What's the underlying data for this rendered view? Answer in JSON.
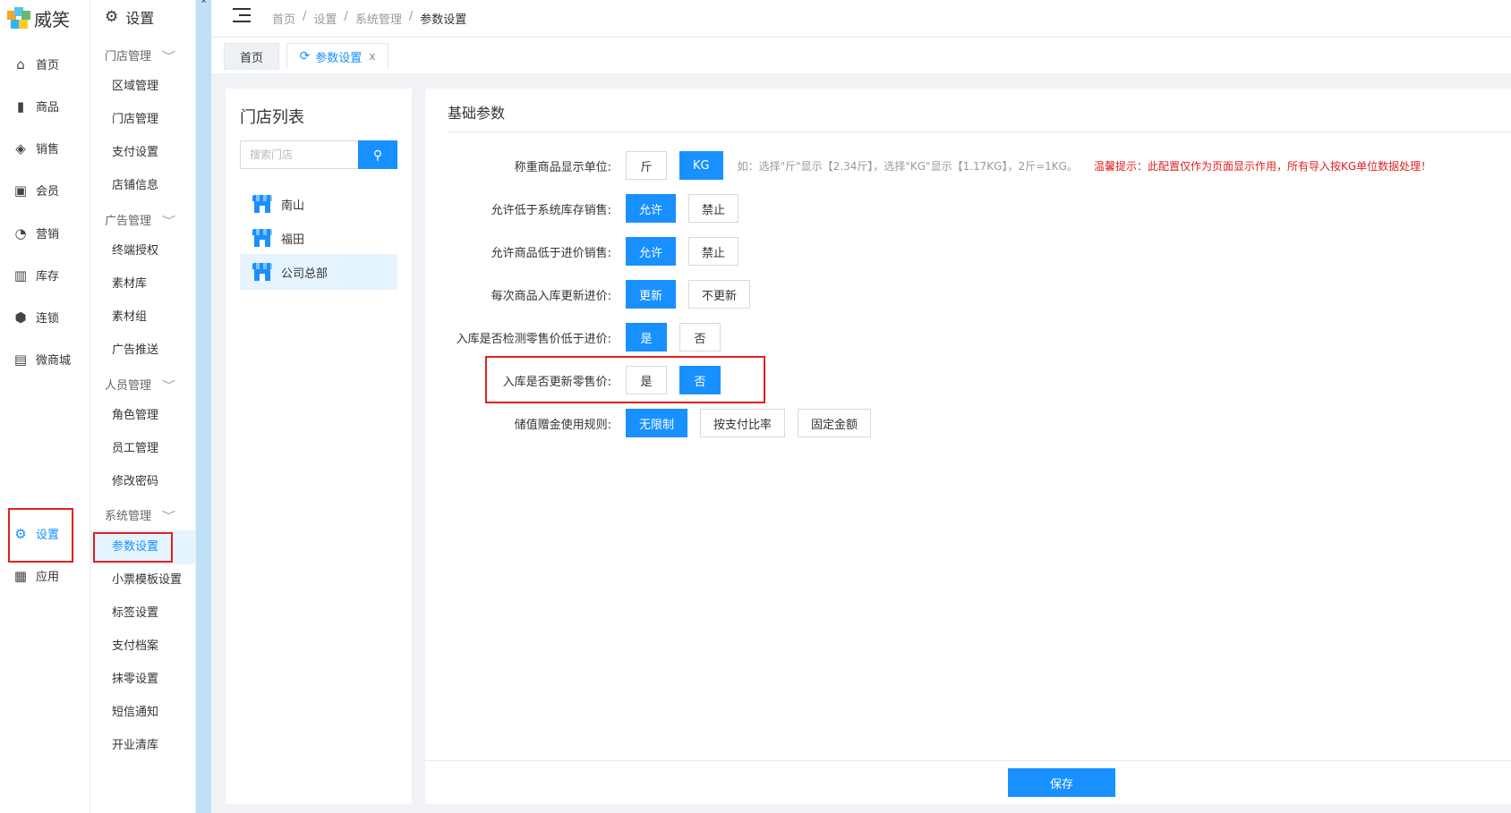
{
  "app": {
    "logo_text": "威笑"
  },
  "nav": {
    "items": [
      {
        "label": "首页",
        "icon": "home-icon"
      },
      {
        "label": "商品",
        "icon": "bag-icon"
      },
      {
        "label": "销售",
        "icon": "tag-icon"
      },
      {
        "label": "会员",
        "icon": "card-icon"
      },
      {
        "label": "营销",
        "icon": "gauge-icon"
      },
      {
        "label": "库存",
        "icon": "kanban-icon"
      },
      {
        "label": "连锁",
        "icon": "cube-icon"
      },
      {
        "label": "微商城",
        "icon": "store-icon"
      },
      {
        "label": "设置",
        "icon": "gear-icon"
      },
      {
        "label": "应用",
        "icon": "grid-icon"
      }
    ]
  },
  "submenu": {
    "title": "设置",
    "groups": [
      {
        "label": "门店管理",
        "items": [
          "区域管理",
          "门店管理",
          "支付设置",
          "店铺信息"
        ]
      },
      {
        "label": "广告管理",
        "items": [
          "终端授权",
          "素材库",
          "素材组",
          "广告推送"
        ]
      },
      {
        "label": "人员管理",
        "items": [
          "角色管理",
          "员工管理",
          "修改密码"
        ]
      },
      {
        "label": "系统管理",
        "items": [
          "参数设置",
          "小票模板设置",
          "标签设置",
          "支付档案",
          "抹零设置",
          "短信通知",
          "开业清库"
        ]
      }
    ]
  },
  "breadcrumb": [
    "首页",
    "/",
    "设置",
    "/",
    "系统管理",
    "/",
    "参数设置"
  ],
  "tabs": [
    {
      "label": "首页"
    },
    {
      "label": "参数设置",
      "close": "x"
    }
  ],
  "store_panel": {
    "title": "门店列表",
    "search_placeholder": "搜索门店",
    "stores": [
      "南山",
      "福田",
      "公司总部"
    ]
  },
  "settings": {
    "title": "基础参数",
    "rows": [
      {
        "label": "称重商品显示单位:",
        "options": [
          "斤",
          "KG"
        ],
        "selected": 1,
        "hint": "如：选择\"斤\"显示【2.34斤】，选择\"KG\"显示【1.17KG】，2斤=1KG。",
        "warning": "温馨提示：此配置仅作为页面显示作用，所有导入按KG单位数据处理！"
      },
      {
        "label": "允许低于系统库存销售:",
        "options": [
          "允许",
          "禁止"
        ],
        "selected": 0
      },
      {
        "label": "允许商品低于进价销售:",
        "options": [
          "允许",
          "禁止"
        ],
        "selected": 0
      },
      {
        "label": "每次商品入库更新进价:",
        "options": [
          "更新",
          "不更新"
        ],
        "selected": 0
      },
      {
        "label": "入库是否检测零售价低于进价:",
        "options": [
          "是",
          "否"
        ],
        "selected": 0
      },
      {
        "label": "入库是否更新零售价:",
        "options": [
          "是",
          "否"
        ],
        "selected": 1
      },
      {
        "label": "储值赠金使用规则:",
        "options": [
          "无限制",
          "按支付比率",
          "固定金额"
        ],
        "selected": 0
      }
    ],
    "save_label": "保存"
  },
  "colors": {
    "accent": "#1890ff",
    "highlight": "#e02020"
  }
}
